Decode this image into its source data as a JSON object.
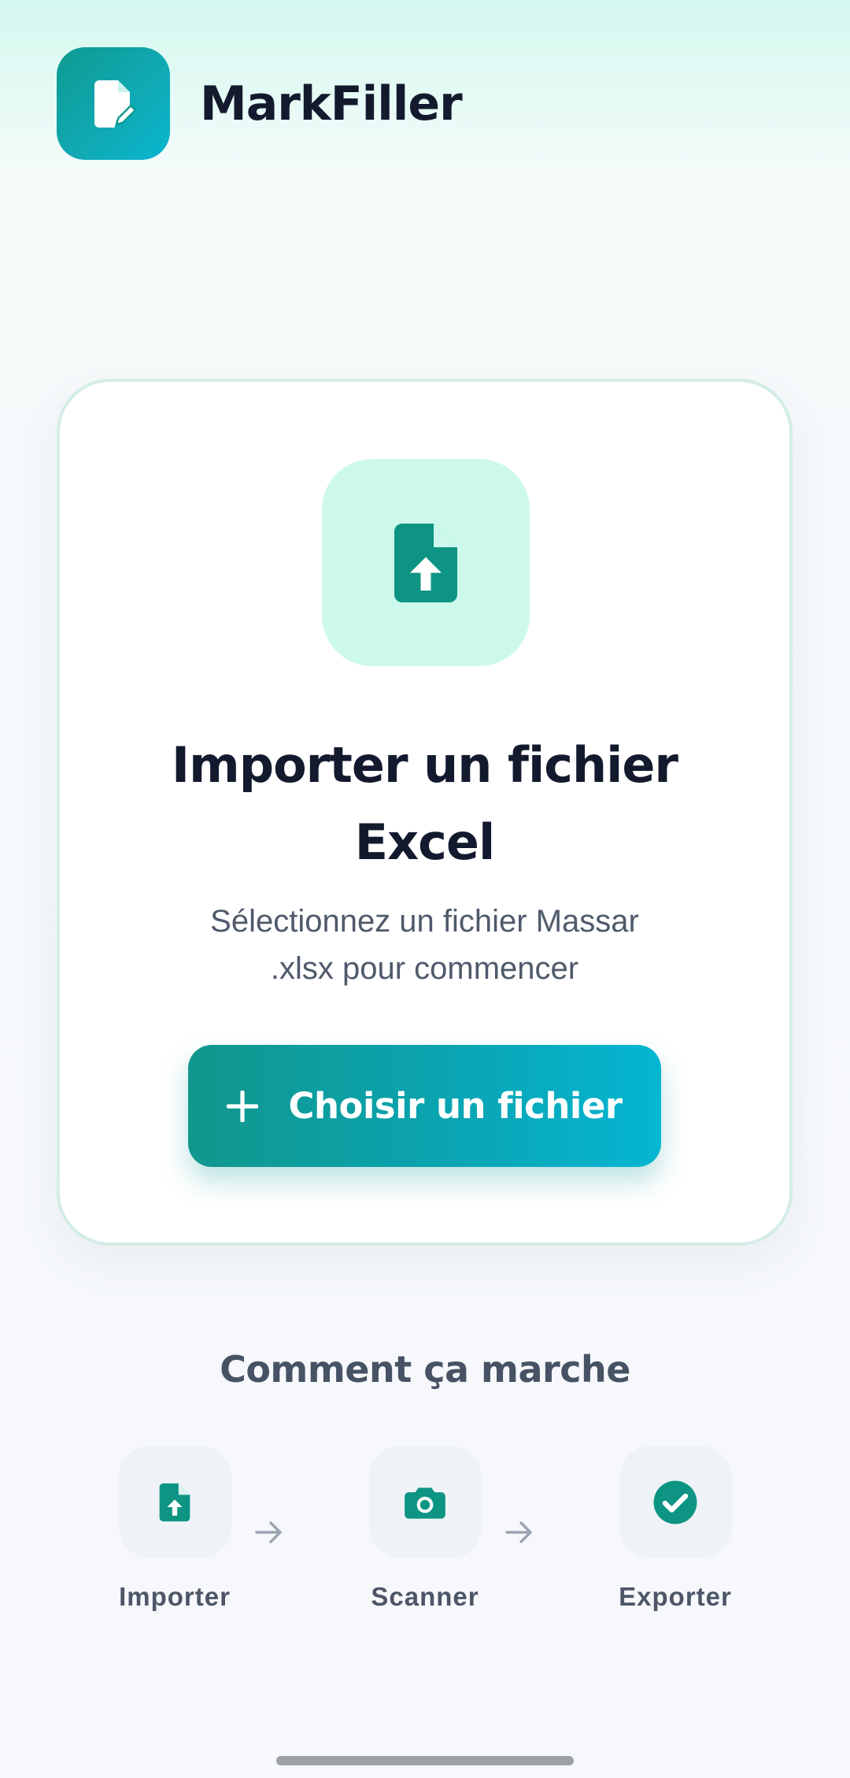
{
  "app": {
    "title": "MarkFiller",
    "logo_icon": "file-edit-icon",
    "brand_color": "#0e9a90"
  },
  "import_card": {
    "icon": "file-upload-icon",
    "title": "Importer un fichier Excel",
    "subtitle": "Sélectionnez un fichier Massar .xlsx pour commencer",
    "button_label": "Choisir un fichier",
    "button_icon": "plus-icon"
  },
  "how_it_works": {
    "title": "Comment ça marche",
    "steps": [
      {
        "label": "Importer",
        "icon": "file-upload-icon"
      },
      {
        "label": "Scanner",
        "icon": "camera-icon"
      },
      {
        "label": "Exporter",
        "icon": "check-circle-icon"
      }
    ]
  }
}
